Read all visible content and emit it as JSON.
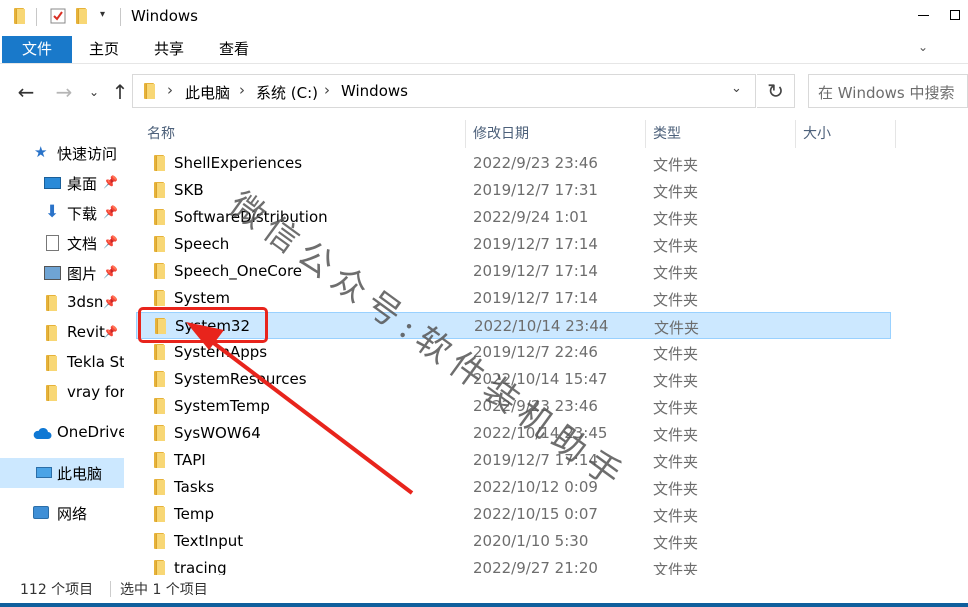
{
  "window": {
    "title": "Windows"
  },
  "ribbon": {
    "tabs": [
      {
        "label": "文件",
        "active": true
      },
      {
        "label": "主页"
      },
      {
        "label": "共享"
      },
      {
        "label": "查看"
      }
    ]
  },
  "address": {
    "segments": [
      "此电脑",
      "系统 (C:)",
      "Windows"
    ]
  },
  "search": {
    "placeholder": "在 Windows 中搜索"
  },
  "sidebar": {
    "items": [
      {
        "label": "快速访问",
        "icon": "star-icon"
      },
      {
        "label": "桌面",
        "icon": "desktop-icon",
        "pinned": true
      },
      {
        "label": "下载",
        "icon": "download-icon",
        "pinned": true
      },
      {
        "label": "文档",
        "icon": "document-icon",
        "pinned": true
      },
      {
        "label": "图片",
        "icon": "picture-icon",
        "pinned": true
      },
      {
        "label": "3dsn",
        "icon": "folder-icon",
        "pinned": true
      },
      {
        "label": "Revit",
        "icon": "folder-icon",
        "pinned": true
      },
      {
        "label": "Tekla St",
        "icon": "folder-icon"
      },
      {
        "label": "vray for",
        "icon": "folder-icon"
      },
      {
        "label": "OneDrive",
        "icon": "cloud-icon"
      },
      {
        "label": "此电脑",
        "icon": "computer-icon",
        "selected": true
      },
      {
        "label": "网络",
        "icon": "network-icon"
      }
    ]
  },
  "columns": {
    "name": "名称",
    "date": "修改日期",
    "type": "类型",
    "size": "大小"
  },
  "files": [
    {
      "name": "ShellExperiences",
      "date": "2022/9/23 23:46",
      "type": "文件夹"
    },
    {
      "name": "SKB",
      "date": "2019/12/7 17:31",
      "type": "文件夹"
    },
    {
      "name": "SoftwareDistribution",
      "date": "2022/9/24 1:01",
      "type": "文件夹"
    },
    {
      "name": "Speech",
      "date": "2019/12/7 17:14",
      "type": "文件夹"
    },
    {
      "name": "Speech_OneCore",
      "date": "2019/12/7 17:14",
      "type": "文件夹"
    },
    {
      "name": "System",
      "date": "2019/12/7 17:14",
      "type": "文件夹"
    },
    {
      "name": "System32",
      "date": "2022/10/14 23:44",
      "type": "文件夹",
      "selected": true
    },
    {
      "name": "SystemApps",
      "date": "2019/12/7 22:46",
      "type": "文件夹"
    },
    {
      "name": "SystemResources",
      "date": "2022/10/14 15:47",
      "type": "文件夹"
    },
    {
      "name": "SystemTemp",
      "date": "2022/9/23 23:46",
      "type": "文件夹"
    },
    {
      "name": "SysWOW64",
      "date": "2022/10/14 23:45",
      "type": "文件夹"
    },
    {
      "name": "TAPI",
      "date": "2019/12/7 17:14",
      "type": "文件夹"
    },
    {
      "name": "Tasks",
      "date": "2022/10/12 0:09",
      "type": "文件夹"
    },
    {
      "name": "Temp",
      "date": "2022/10/15 0:07",
      "type": "文件夹"
    },
    {
      "name": "TextInput",
      "date": "2020/1/10 5:30",
      "type": "文件夹"
    },
    {
      "name": "tracing",
      "date": "2022/9/27 21:20",
      "type": "文件夹"
    }
  ],
  "status": {
    "count": "112 个项目",
    "selection": "选中 1 个项目"
  },
  "overlay": {
    "watermark": "微信公众号:软件装机助手",
    "annotation_color": "#e8241c"
  },
  "colors": {
    "accent": "#1979ca",
    "selection": "#cce8ff",
    "folder": "#f8d775"
  }
}
